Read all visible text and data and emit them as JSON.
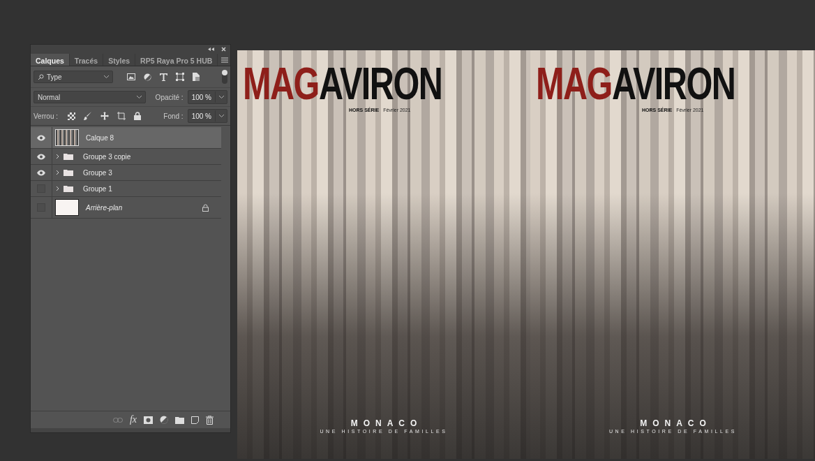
{
  "layers_panel": {
    "tabs": [
      {
        "label": "Calques",
        "selected": true
      },
      {
        "label": "Tracés",
        "selected": false
      },
      {
        "label": "Styles",
        "selected": false
      },
      {
        "label": "RP5 Raya Pro 5 HUB",
        "selected": false
      }
    ],
    "filter": {
      "value": "Type",
      "toggle_on": true
    },
    "blend_mode": {
      "value": "Normal"
    },
    "opacity": {
      "label": "Opacité :",
      "value": "100 %"
    },
    "lock": {
      "label": "Verrou :"
    },
    "fill": {
      "label": "Fond :",
      "value": "100 %"
    },
    "layers": [
      {
        "kind": "layer",
        "name": "Calque 8",
        "visible": true,
        "selected": true,
        "locked": false
      },
      {
        "kind": "group",
        "name": "Groupe 3 copie",
        "visible": true,
        "selected": false,
        "locked": false
      },
      {
        "kind": "group",
        "name": "Groupe 3",
        "visible": true,
        "selected": false,
        "locked": false
      },
      {
        "kind": "group",
        "name": "Groupe 1",
        "visible": false,
        "selected": false,
        "locked": false
      },
      {
        "kind": "background",
        "name": "Arrière-plan",
        "visible": false,
        "selected": false,
        "locked": true
      }
    ]
  },
  "bottom_bar": {
    "effects_label": "fx"
  },
  "canvas": {
    "covers": [
      {
        "masthead_prefix": "MAG",
        "masthead_word": "AVIRON",
        "edition": "HORS SÉRIE",
        "date": "Février 2021",
        "headline": "MONACO",
        "tagline": "UNE HISTOIRE DE FAMILLES"
      },
      {
        "masthead_prefix": "MAG",
        "masthead_word": "AVIRON",
        "edition": "HORS SÉRIE",
        "date": "Février 2021",
        "headline": "MONACO",
        "tagline": "UNE HISTOIRE DE FAMILLES"
      }
    ]
  }
}
